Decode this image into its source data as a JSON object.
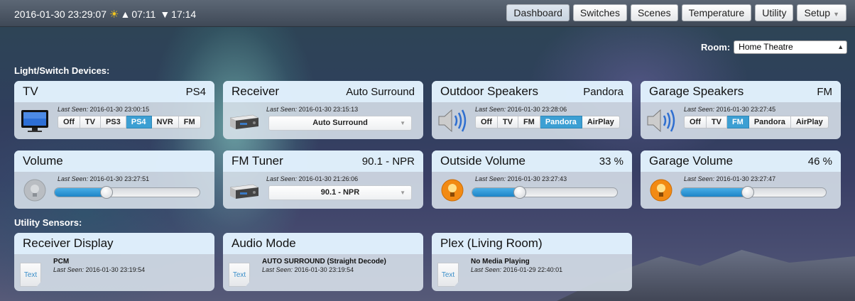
{
  "topbar": {
    "datetime": "2016-01-30 23:29:07",
    "sunrise": "07:11",
    "sunset": "17:14",
    "nav": [
      "Dashboard",
      "Switches",
      "Scenes",
      "Temperature",
      "Utility",
      "Setup"
    ],
    "active_nav": "Dashboard"
  },
  "room": {
    "label": "Room:",
    "selected": "Home Theatre"
  },
  "sections": {
    "devices": "Light/Switch Devices:",
    "sensors": "Utility Sensors:"
  },
  "last_seen_label": "Last Seen:",
  "devices": {
    "tv": {
      "title": "TV",
      "status": "PS4",
      "last_seen": "2016-01-30 23:00:15",
      "options": [
        "Off",
        "TV",
        "PS3",
        "PS4",
        "NVR",
        "FM"
      ],
      "selected": "PS4"
    },
    "receiver": {
      "title": "Receiver",
      "status": "Auto Surround",
      "last_seen": "2016-01-30 23:15:13",
      "dropdown": "Auto Surround"
    },
    "outdoor": {
      "title": "Outdoor Speakers",
      "status": "Pandora",
      "last_seen": "2016-01-30 23:28:06",
      "options": [
        "Off",
        "TV",
        "FM",
        "Pandora",
        "AirPlay"
      ],
      "selected": "Pandora"
    },
    "garage": {
      "title": "Garage Speakers",
      "status": "FM",
      "last_seen": "2016-01-30 23:27:45",
      "options": [
        "Off",
        "TV",
        "FM",
        "Pandora",
        "AirPlay"
      ],
      "selected": "FM"
    },
    "volume": {
      "title": "Volume",
      "status": "",
      "last_seen": "2016-01-30 23:27:51",
      "level_percent": 36
    },
    "fmtuner": {
      "title": "FM Tuner",
      "status": "90.1 - NPR",
      "last_seen": "2016-01-30 21:26:06",
      "dropdown": "90.1 - NPR"
    },
    "outside_volume": {
      "title": "Outside Volume",
      "status": "33 %",
      "last_seen": "2016-01-30 23:27:43",
      "level_percent": 33
    },
    "garage_volume": {
      "title": "Garage Volume",
      "status": "46 %",
      "last_seen": "2016-01-30 23:27:47",
      "level_percent": 46
    }
  },
  "sensors": {
    "receiver_display": {
      "title": "Receiver Display",
      "value": "PCM",
      "last_seen": "2016-01-30 23:19:54",
      "icon_text": "Text"
    },
    "audio_mode": {
      "title": "Audio Mode",
      "value": "AUTO SURROUND (Straight Decode)",
      "last_seen": "2016-01-30 23:19:54",
      "icon_text": "Text"
    },
    "plex": {
      "title": "Plex (Living Room)",
      "value": "No Media Playing",
      "last_seen": "2016-01-29 22:40:01",
      "icon_text": "Text"
    }
  }
}
